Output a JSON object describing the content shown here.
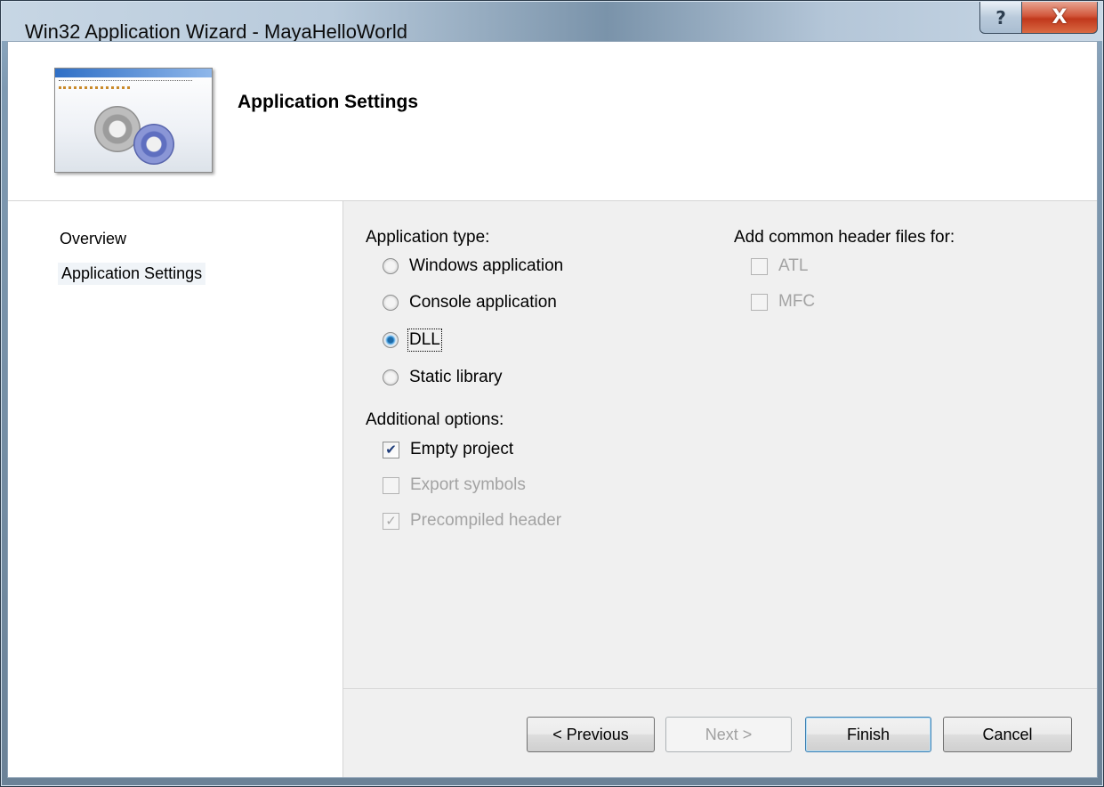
{
  "window": {
    "title": "Win32 Application Wizard - MayaHelloWorld",
    "help_glyph": "?",
    "close_glyph": "X"
  },
  "header": {
    "title": "Application Settings",
    "banner_icon": "gears-window-icon"
  },
  "sidebar": {
    "items": [
      {
        "label": "Overview",
        "selected": false
      },
      {
        "label": "Application Settings",
        "selected": true
      }
    ]
  },
  "application_type": {
    "label": "Application type:",
    "options": [
      {
        "label": "Windows application",
        "checked": false
      },
      {
        "label": "Console application",
        "checked": false
      },
      {
        "label": "DLL",
        "checked": true
      },
      {
        "label": "Static library",
        "checked": false
      }
    ]
  },
  "additional_options": {
    "label": "Additional options:",
    "options": [
      {
        "label": "Empty project",
        "checked": true,
        "enabled": true
      },
      {
        "label": "Export symbols",
        "checked": false,
        "enabled": false
      },
      {
        "label": "Precompiled header",
        "checked": true,
        "enabled": false
      }
    ]
  },
  "common_headers": {
    "label": "Add common header files for:",
    "options": [
      {
        "label": "ATL",
        "checked": false,
        "enabled": false
      },
      {
        "label": "MFC",
        "checked": false,
        "enabled": false
      }
    ]
  },
  "buttons": {
    "previous": "< Previous",
    "next": "Next >",
    "finish": "Finish",
    "cancel": "Cancel"
  },
  "colors": {
    "title_bar": "#b8cadb",
    "close_button": "#c1381c",
    "client_bg": "#f0f0f0"
  }
}
